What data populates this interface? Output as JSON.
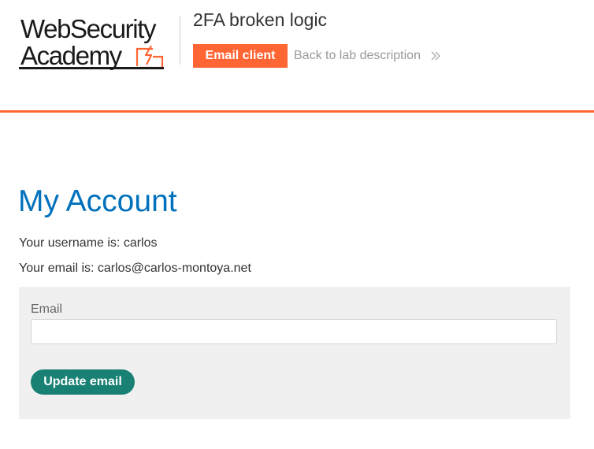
{
  "header": {
    "logo": {
      "line1": "WebSecurity",
      "line2": "Academy"
    },
    "lab_title": "2FA broken logic",
    "email_client_label": "Email client",
    "back_link_label": "Back to lab description"
  },
  "main": {
    "title": "My Account",
    "username_line": "Your username is: carlos",
    "email_line": "Your email is: carlos@carlos-montoya.net",
    "form": {
      "email_label": "Email",
      "email_value": "",
      "update_label": "Update email"
    }
  },
  "colors": {
    "accent": "#ff6633",
    "title_blue": "#0071bc",
    "button_green": "#188174",
    "form_bg": "#f0f0f0"
  },
  "icons": {
    "logo_mark": "lightning-bolt-icon",
    "back_link": "double-chevron-right-icon"
  }
}
